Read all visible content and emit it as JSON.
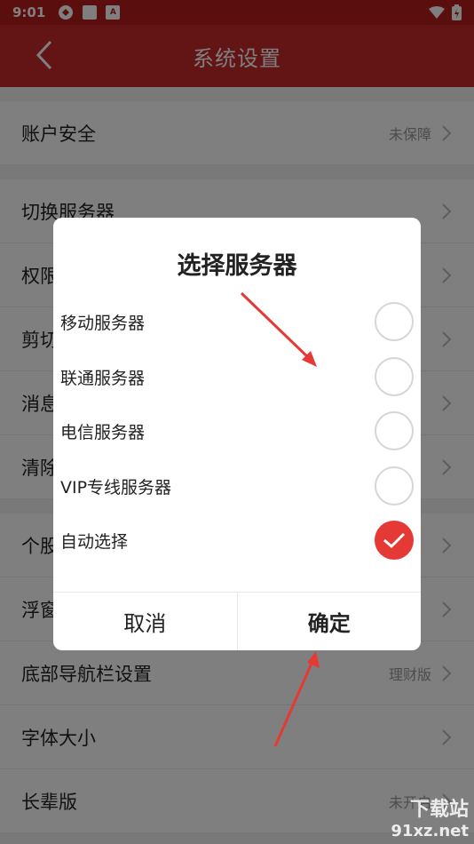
{
  "status_bar": {
    "time": "9:01"
  },
  "header": {
    "title": "系统设置"
  },
  "settings": {
    "group1": [
      {
        "label": "账户安全",
        "value": "未保障"
      }
    ],
    "group2": [
      {
        "label": "切换服务器",
        "value": ""
      },
      {
        "label": "权限",
        "value": ""
      },
      {
        "label": "剪切",
        "value": ""
      },
      {
        "label": "消息",
        "value": ""
      },
      {
        "label": "清除",
        "value": ""
      }
    ],
    "group3": [
      {
        "label": "个股",
        "value": ""
      },
      {
        "label": "浮窗",
        "value": ""
      },
      {
        "label": "底部导航栏设置",
        "value": "理财版"
      },
      {
        "label": "字体大小",
        "value": ""
      },
      {
        "label": "长辈版",
        "value": "未开启"
      }
    ]
  },
  "dialog": {
    "title": "选择服务器",
    "options": [
      {
        "label": "移动服务器",
        "checked": false
      },
      {
        "label": "联通服务器",
        "checked": false
      },
      {
        "label": "电信服务器",
        "checked": false
      },
      {
        "label": "VIP专线服务器",
        "checked": false
      },
      {
        "label": "自动选择",
        "checked": true
      }
    ],
    "cancel": "取消",
    "confirm": "确定"
  },
  "watermark": {
    "brand": "下载站",
    "site": "91xz.net"
  },
  "colors": {
    "primary": "#c62828",
    "check": "#e53935"
  }
}
